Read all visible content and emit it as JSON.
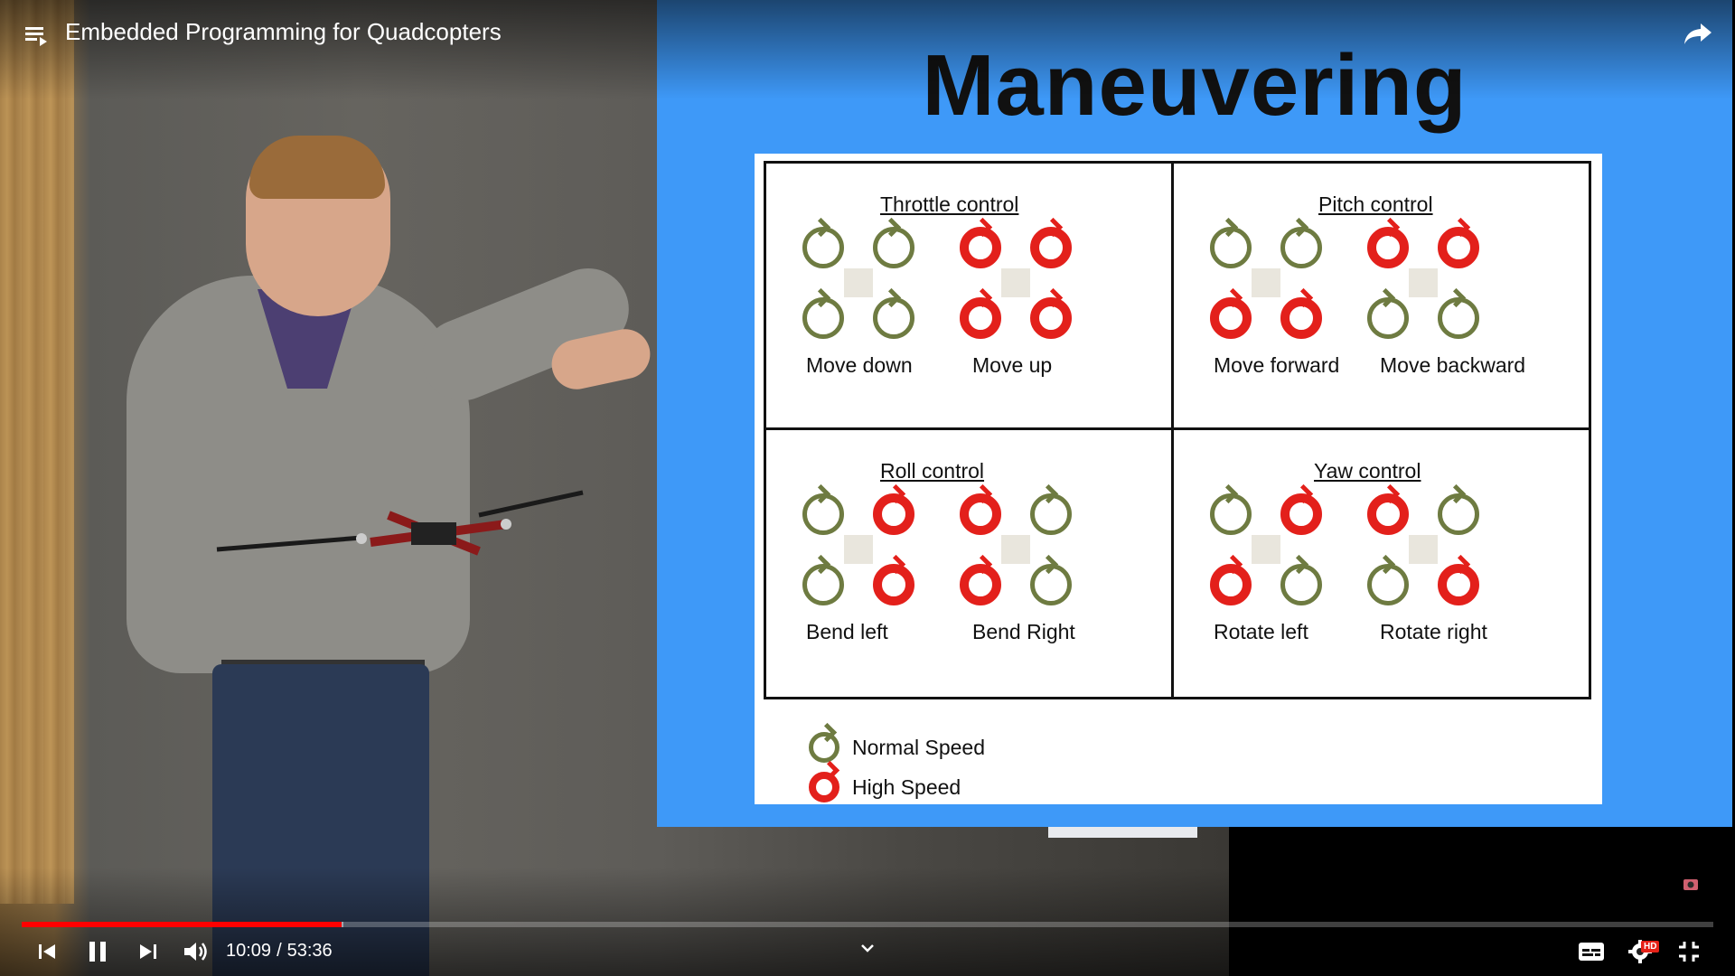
{
  "player": {
    "title": "Embedded Programming for Quadcopters",
    "time_current": "10:09",
    "time_separator": "/",
    "time_total": "53:36",
    "progress_played_fraction": 0.189,
    "progress_buffered_fraction": 0.19,
    "hd_label": "HD",
    "icons": {
      "playlist": "playlist-icon",
      "share": "share-icon",
      "previous": "previous-icon",
      "pause": "pause-icon",
      "next": "next-icon",
      "volume": "volume-icon",
      "chapters": "chevron-down-icon",
      "subtitles": "subtitles-icon",
      "settings": "settings-gear-icon",
      "fullscreen_exit": "exit-fullscreen-icon"
    },
    "colors": {
      "progress": "#ff0000",
      "slide_bg": "#3e99f8",
      "high_speed": "#e3201b",
      "normal_speed": "#6e7b41"
    }
  },
  "slide": {
    "title": "Maneuvering",
    "cells": [
      {
        "title": "Throttle control",
        "cases": [
          {
            "label": "Move down",
            "rotors": [
              "n",
              "n",
              "n",
              "n"
            ]
          },
          {
            "label": "Move up",
            "rotors": [
              "h",
              "h",
              "h",
              "h"
            ]
          }
        ]
      },
      {
        "title": "Pitch control",
        "cases": [
          {
            "label": "Move forward",
            "rotors": [
              "n",
              "n",
              "h",
              "h"
            ]
          },
          {
            "label": "Move backward",
            "rotors": [
              "h",
              "h",
              "n",
              "n"
            ]
          }
        ]
      },
      {
        "title": "Roll control",
        "cases": [
          {
            "label": "Bend left",
            "rotors": [
              "n",
              "h",
              "n",
              "h"
            ]
          },
          {
            "label": "Bend Right",
            "rotors": [
              "h",
              "n",
              "h",
              "n"
            ]
          }
        ]
      },
      {
        "title": "Yaw control",
        "cases": [
          {
            "label": "Rotate left",
            "rotors": [
              "n",
              "h",
              "h",
              "n"
            ]
          },
          {
            "label": "Rotate right",
            "rotors": [
              "h",
              "n",
              "n",
              "h"
            ]
          }
        ]
      }
    ],
    "legend": [
      {
        "label": "Normal Speed",
        "kind": "n"
      },
      {
        "label": "High Speed",
        "kind": "h"
      }
    ]
  }
}
